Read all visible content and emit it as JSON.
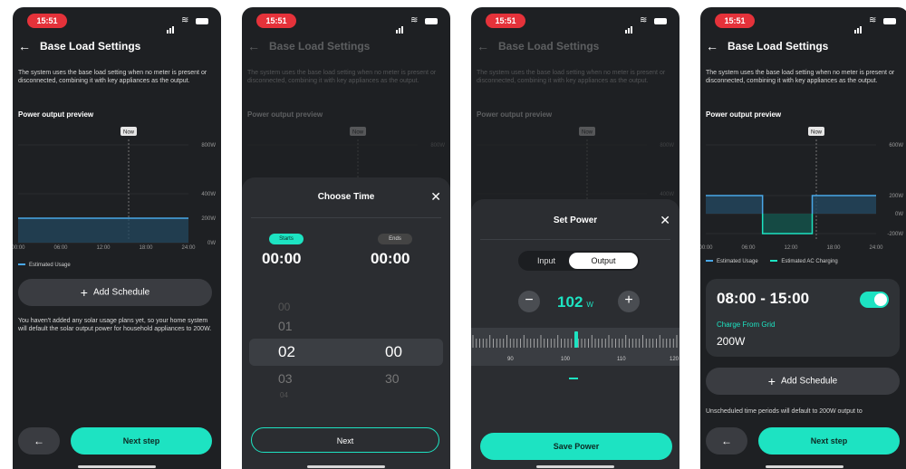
{
  "status": {
    "time": "15:51"
  },
  "header": {
    "back": "←",
    "title": "Base Load Settings"
  },
  "description": "The system uses the base load setting when no meter is present or disconnected, combining it with key appliances as the output.",
  "preview_title": "Power output preview",
  "chart": {
    "now_label": "Now",
    "y_ticks_1": [
      "800W",
      "400W",
      "200W",
      "0W"
    ],
    "y_ticks_4": [
      "600W",
      "200W",
      "0W",
      "-200W"
    ],
    "x_ticks": [
      "00:00",
      "06:00",
      "12:00",
      "18:00",
      "24:00"
    ]
  },
  "chart_data": [
    {
      "type": "line",
      "x": [
        "00:00",
        "06:00",
        "12:00",
        "18:00",
        "24:00"
      ],
      "series": [
        {
          "name": "Estimated Usage",
          "values": [
            200,
            200,
            200,
            200,
            200
          ]
        }
      ],
      "ylabel": "",
      "y_ticks": [
        "800W",
        "400W",
        "200W",
        "0W"
      ]
    },
    {
      "type": "area",
      "x": [
        "00:00",
        "08:00",
        "08:00",
        "15:00",
        "15:00",
        "24:00"
      ],
      "series": [
        {
          "name": "Estimated Usage",
          "values": [
            200,
            200,
            0,
            0,
            200,
            200
          ]
        },
        {
          "name": "Estimated AC Charging",
          "values": [
            0,
            0,
            -200,
            -200,
            0,
            0
          ]
        }
      ],
      "y_ticks": [
        "600W",
        "200W",
        "0W",
        "-200W"
      ]
    }
  ],
  "legend": {
    "usage": "Estimated Usage",
    "charging": "Estimated AC Charging"
  },
  "add_schedule": "Add Schedule",
  "empty_info": "You haven't added any solar usage plans yet, so your home system will default the solar output power for household appliances to 200W.",
  "next_step": "Next step",
  "choose_time": {
    "title": "Choose Time",
    "close": "✕",
    "starts": "Starts",
    "ends": "Ends",
    "start_time": "00:00",
    "end_time": "00:00",
    "hours": [
      "00",
      "01",
      "02",
      "03",
      "04"
    ],
    "minutes": [
      "00",
      "30"
    ],
    "next": "Next"
  },
  "set_power": {
    "title": "Set Power",
    "close": "✕",
    "input": "Input",
    "output": "Output",
    "minus": "−",
    "plus": "+",
    "value": "102",
    "unit": "W",
    "ruler_labels": [
      "90",
      "100",
      "110",
      "120"
    ],
    "save": "Save Power"
  },
  "schedule": {
    "time_range": "08:00 - 15:00",
    "mode": "Charge From Grid",
    "power": "200W",
    "enabled": true
  },
  "unscheduled_info": "Unscheduled time periods will default to 200W output to",
  "colors": {
    "accent": "#1de3c2",
    "usage": "#49a8e8",
    "status": "#e5323a"
  }
}
